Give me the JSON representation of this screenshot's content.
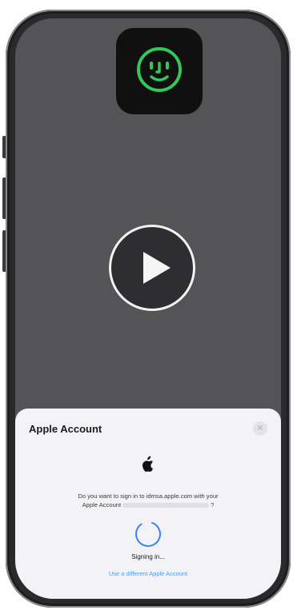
{
  "video": {
    "faceid_icon": "face-id-icon",
    "play_icon": "play-icon"
  },
  "sheet": {
    "title": "Apple Account",
    "close_icon": "close-icon",
    "logo_icon": "apple-logo-icon",
    "prompt_line1": "Do you want to sign in to idmsa.apple.com with your",
    "prompt_line2_prefix": "Apple Account",
    "prompt_line2_suffix": "?",
    "status": "Signing in...",
    "alt_account_link": "Use a different Apple Account"
  },
  "colors": {
    "faceid": "#35c759",
    "link": "#4a9cf0",
    "spinner": "#3b82f6",
    "sheet_bg": "#f2f2f7"
  }
}
